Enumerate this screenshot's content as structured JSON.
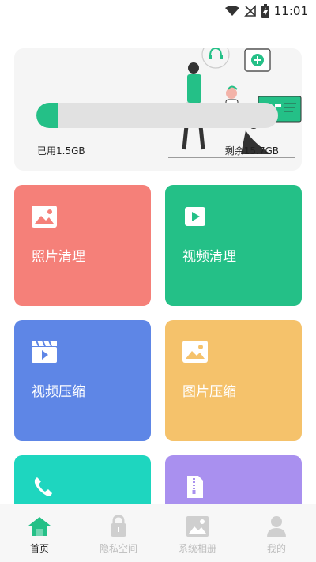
{
  "status_bar": {
    "time": "11:01",
    "icons": [
      "wifi-icon",
      "no-signal-icon",
      "battery-charging-icon"
    ]
  },
  "storage": {
    "used_label": "已用1.5GB",
    "remaining_label": "剩余15.7GB",
    "used_fraction": 0.087,
    "bar_color": "#24c087"
  },
  "tiles": [
    {
      "label": "照片清理",
      "icon": "photo-icon",
      "color": "#f58079"
    },
    {
      "label": "视频清理",
      "icon": "video-play-icon",
      "color": "#24c087"
    },
    {
      "label": "视频压缩",
      "icon": "video-clapper-icon",
      "color": "#5e86e6"
    },
    {
      "label": "图片压缩",
      "icon": "image-icon",
      "color": "#f5c26b"
    },
    {
      "label": "",
      "icon": "phone-icon",
      "color": "#1ed6bf"
    },
    {
      "label": "",
      "icon": "zip-file-icon",
      "color": "#a990ef"
    }
  ],
  "nav": {
    "items": [
      {
        "label": "首页",
        "icon": "home-icon",
        "active": true
      },
      {
        "label": "隐私空间",
        "icon": "lock-icon",
        "active": false
      },
      {
        "label": "系统相册",
        "icon": "album-icon",
        "active": false
      },
      {
        "label": "我的",
        "icon": "profile-icon",
        "active": false
      }
    ],
    "active_color": "#24c087",
    "inactive_color": "#cfcfcf"
  }
}
